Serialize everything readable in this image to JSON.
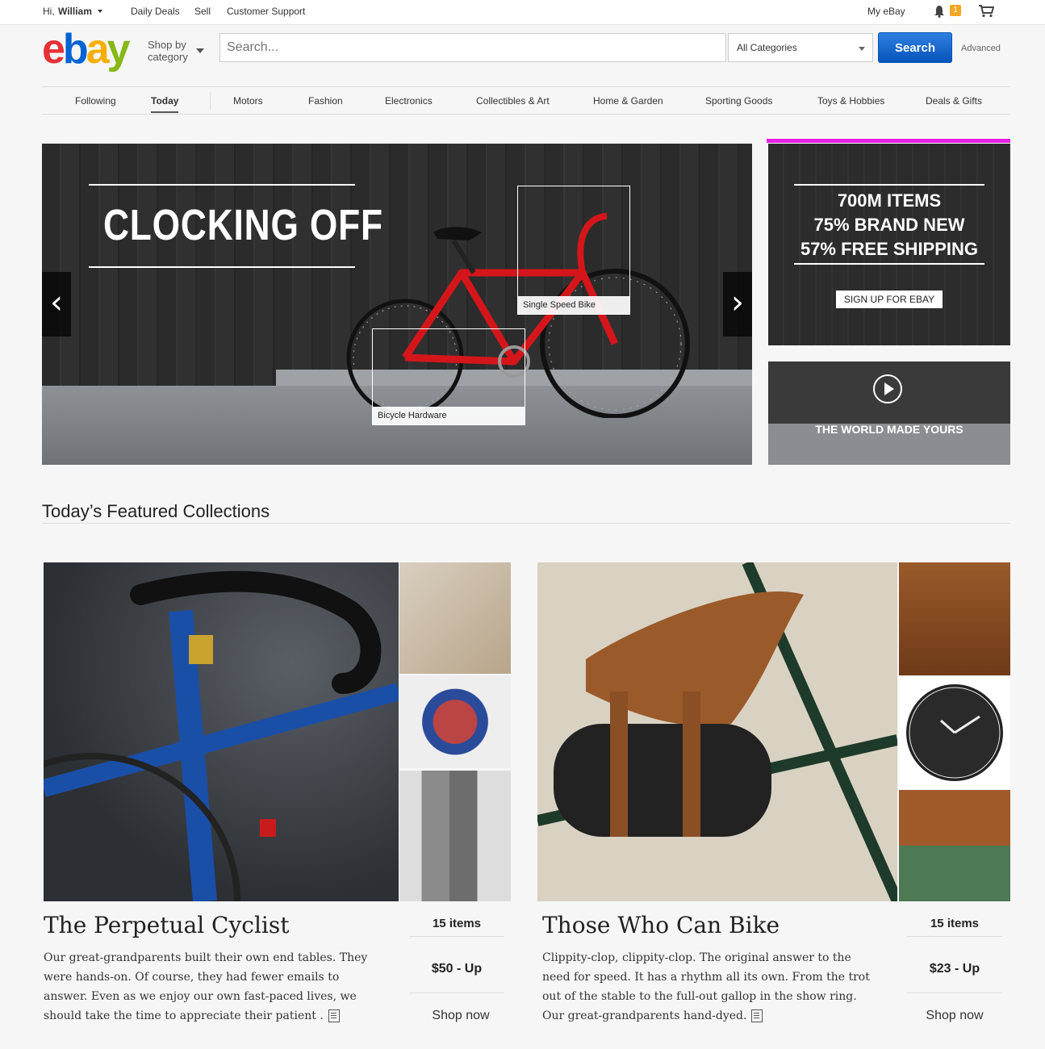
{
  "topbar": {
    "greeting": "Hi,",
    "username": "William",
    "daily_deals": "Daily Deals",
    "sell": "Sell",
    "customer_support": "Customer Support",
    "my_ebay": "My eBay",
    "notification_count": "1"
  },
  "header": {
    "logo": {
      "e": "e",
      "b": "b",
      "a": "a",
      "y": "y"
    },
    "shop_by": "Shop by",
    "category": "category",
    "search_placeholder": "Search...",
    "category_select": "All Categories",
    "search_button": "Search",
    "advanced": "Advanced"
  },
  "nav": {
    "items": [
      "Following",
      "Today",
      "Motors",
      "Fashion",
      "Electronics",
      "Collectibles & Art",
      "Home & Garden",
      "Sporting Goods",
      "Toys & Hobbies",
      "Deals & Gifts"
    ],
    "active": "Today"
  },
  "hero": {
    "title": "CLOCKING OFF",
    "hotspot_1": "Single Speed Bike",
    "hotspot_2": "Bicycle Hardware",
    "prev_arrow": "‹",
    "next_arrow": "›"
  },
  "promo": {
    "line1": "700M ITEMS",
    "line2": "75% BRAND NEW",
    "line3": "57% FREE SHIPPING",
    "signup": "SIGN UP FOR EBAY",
    "video_caption": "THE WORLD MADE YOURS"
  },
  "featured": {
    "heading": "Today’s Featured Collections",
    "collections": [
      {
        "title": "The Perpetual Cyclist",
        "description": "Our great-grandparents built their own end tables. They were hands-on. Of course, they had fewer emails to answer. Even as we enjoy our own fast-paced lives, we should take the time to appreciate their patient .",
        "count": "15 items",
        "price": "$50 - Up",
        "shop": "Shop now"
      },
      {
        "title": "Those Who Can Bike",
        "description": "Clippity-clop, clippity-clop. The original answer to the need for speed. It has a rhythm all its own. From the trot out of the stable to the full-out gallop in the show ring. Our great-grandparents hand-dyed.",
        "count": "15 items",
        "price": "$23 - Up",
        "shop": "Shop now"
      }
    ]
  },
  "colors": {
    "accent_magenta": "#e91ee9",
    "link_blue": "#0654ba",
    "search_button": "#0654ba"
  }
}
